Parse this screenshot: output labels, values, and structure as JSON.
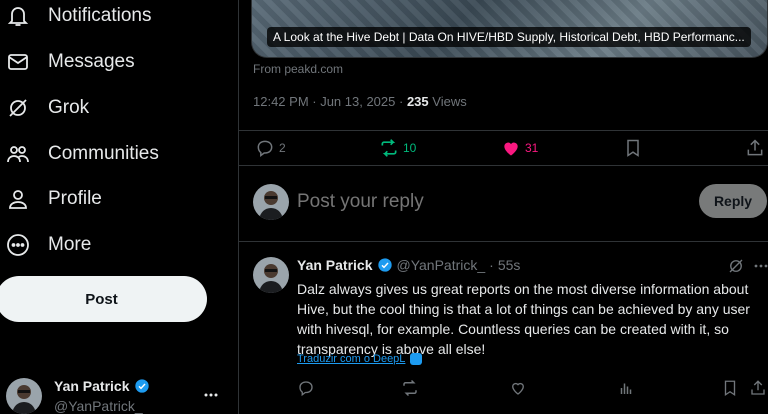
{
  "sidebar": {
    "items": [
      {
        "label": "Notifications",
        "icon": "bell-icon"
      },
      {
        "label": "Messages",
        "icon": "envelope-icon"
      },
      {
        "label": "Grok",
        "icon": "grok-icon"
      },
      {
        "label": "Communities",
        "icon": "communities-icon"
      },
      {
        "label": "Profile",
        "icon": "person-icon"
      },
      {
        "label": "More",
        "icon": "more-circle-icon"
      }
    ],
    "post_label": "Post",
    "account": {
      "name": "Yan Patrick",
      "handle": "@YanPatrick_"
    }
  },
  "post": {
    "card_title": "A Look at the Hive Debt | Data On HIVE/HBD Supply, Historical Debt, HBD Performanc...",
    "from": "From peakd.com",
    "timestamp": "12:42 PM · Jun 13, 2025 ·",
    "views_count": "235",
    "views_label": "Views",
    "replies": "2",
    "reposts": "10",
    "likes": "31"
  },
  "reply": {
    "placeholder": "Post your reply",
    "button_label": "Reply"
  },
  "reply_tweet": {
    "name": "Yan Patrick",
    "handle": "@YanPatrick_",
    "dot": "·",
    "time": "55s",
    "text": "Dalz always gives us great reports on the most diverse information about Hive, but the cool thing is that a lot of things can be achieved by any user with hivesql, for example. Countless queries can be created with it, so transparency is above all else!",
    "translate_label": "Traduzir com o DeepL"
  },
  "colors": {
    "accent": "#1d9bf0",
    "repost": "#00ba7c",
    "like": "#f91880",
    "muted": "#71767b"
  }
}
